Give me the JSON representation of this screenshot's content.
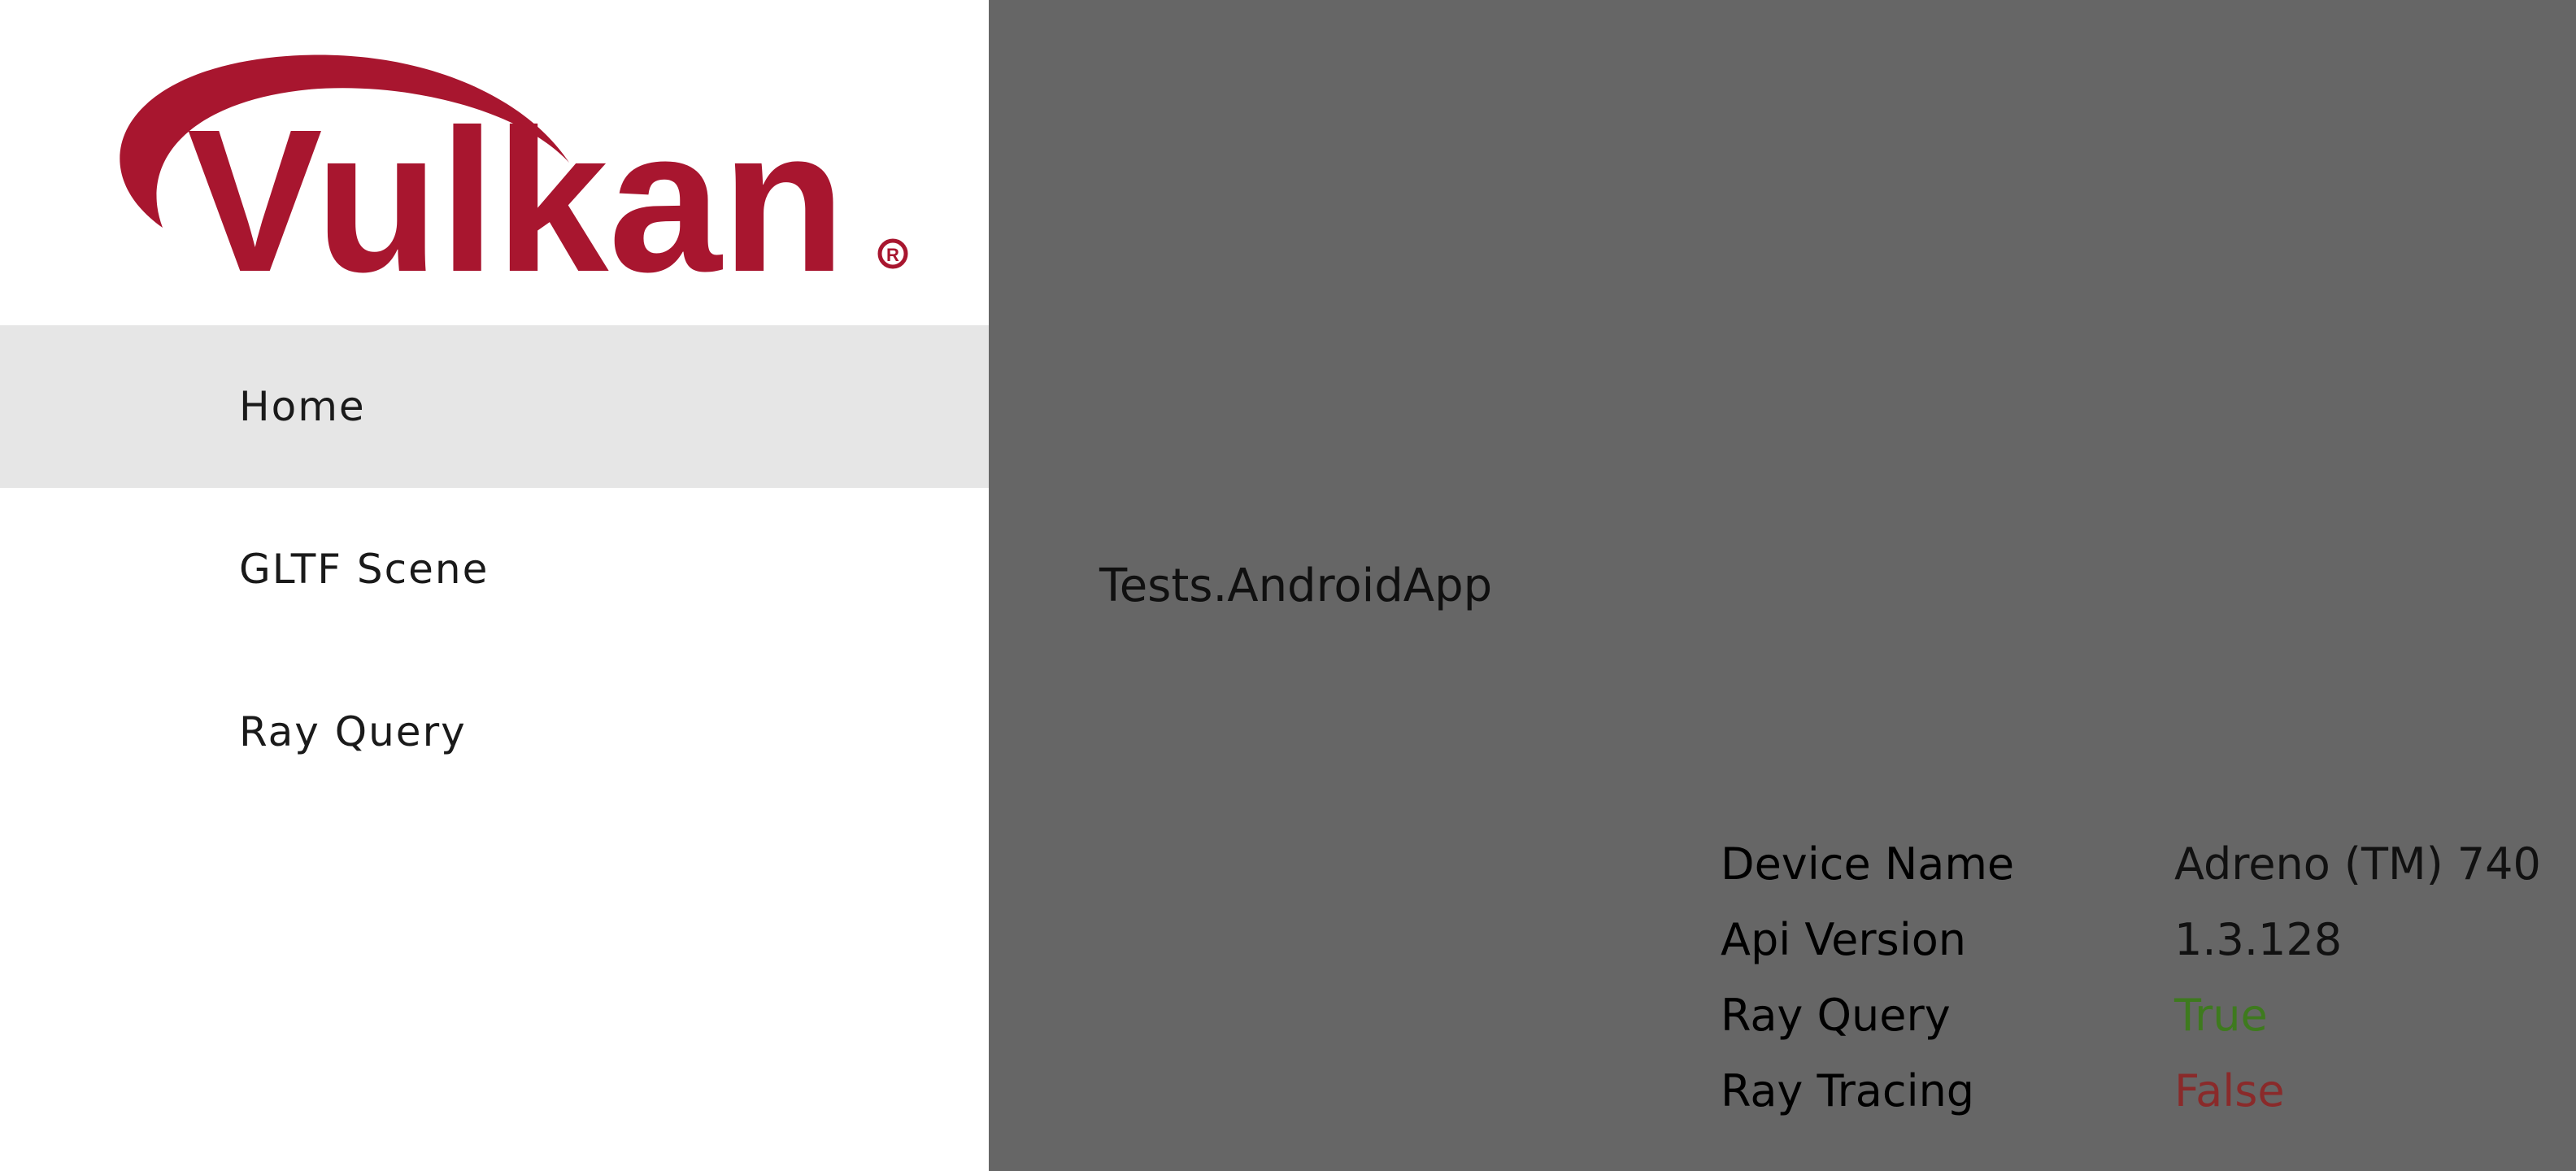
{
  "logo": {
    "text": "Vulkan",
    "registered_mark": "®",
    "color": "#a8162f"
  },
  "sidebar": {
    "items": [
      {
        "label": "Home",
        "active": true
      },
      {
        "label": "GLTF Scene",
        "active": false
      },
      {
        "label": "Ray Query",
        "active": false
      }
    ]
  },
  "main": {
    "app_name": "Tests.AndroidApp",
    "device_info": [
      {
        "key": "Device Name",
        "value": "Adreno (TM) 740"
      },
      {
        "key": "Api Version",
        "value": "1.3.128"
      },
      {
        "key": "Ray Query",
        "value": "True"
      },
      {
        "key": "Ray Tracing",
        "value": "False"
      }
    ]
  },
  "colors": {
    "background": "#666666",
    "sidebar_bg": "#ffffff",
    "active_item_bg": "#e6e6e6",
    "true_value": "#3e7a1e",
    "false_value": "#8a2a2a"
  }
}
